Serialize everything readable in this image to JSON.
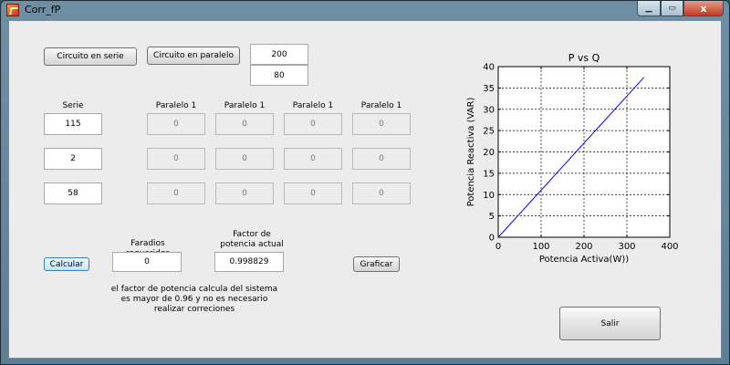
{
  "window": {
    "title": "Corr_fP",
    "close_glyph": "x"
  },
  "buttons": {
    "serie": "Circuito en serie",
    "paralelo": "Circuito en paralelo",
    "calcular": "Calcular",
    "graficar": "Graficar",
    "salir": "Salir"
  },
  "top_inputs": {
    "value1": "200",
    "value2": "80"
  },
  "serie": {
    "header": "Serie",
    "values": [
      "115",
      "2",
      "58"
    ]
  },
  "paralelo": {
    "headers": [
      "Paralelo 1",
      "Paralelo 1",
      "Paralelo 1",
      "Paralelo 1"
    ],
    "rows": [
      [
        "0",
        "0",
        "0",
        "0"
      ],
      [
        "0",
        "0",
        "0",
        "0"
      ],
      [
        "0",
        "0",
        "0",
        "0"
      ]
    ]
  },
  "results": {
    "faradios_label": "Faradios requeridos",
    "faradios_value": "0",
    "fp_label": "Factor de potencia actual",
    "fp_value": "0.998829",
    "message": "el factor de potencia calcula del sistema es mayor de 0.96 y no es necesario realizar correciones"
  },
  "chart_data": {
    "type": "line",
    "title": "P vs Q",
    "xlabel": "Potencia Activa(W))",
    "ylabel": "Potencia Reactiva (VAR)",
    "xlim": [
      0,
      400
    ],
    "ylim": [
      0,
      40
    ],
    "xticks": [
      0,
      100,
      200,
      300,
      400
    ],
    "yticks": [
      0,
      5,
      10,
      15,
      20,
      25,
      30,
      35,
      40
    ],
    "grid": true,
    "series": [
      {
        "x": [
          0,
          340
        ],
        "y": [
          0,
          37.5
        ],
        "color": "#0000ff"
      }
    ]
  }
}
